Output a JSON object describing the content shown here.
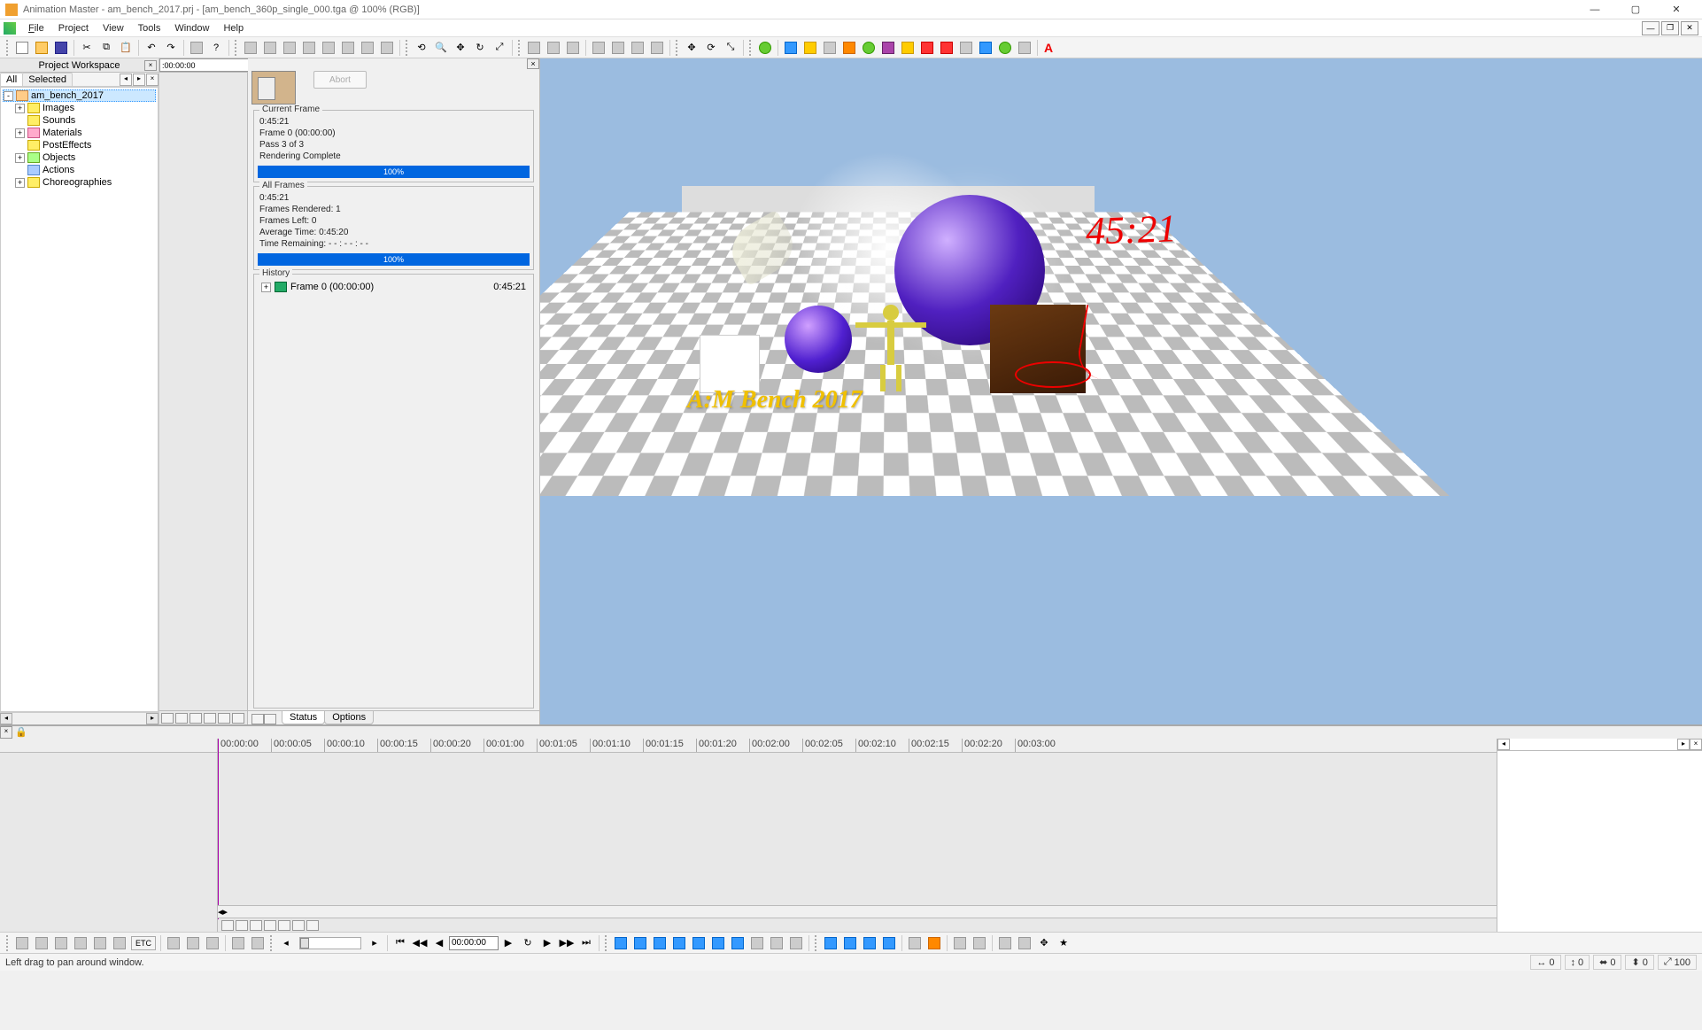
{
  "title": "Animation Master - am_bench_2017.prj - [am_bench_360p_single_000.tga @ 100% (RGB)]",
  "menus": [
    "File",
    "Project",
    "View",
    "Tools",
    "Window",
    "Help"
  ],
  "workspace_label": "Project Workspace",
  "tabs": {
    "all": "All",
    "selected": "Selected"
  },
  "tree": {
    "root": "am_bench_2017",
    "items": [
      "Images",
      "Sounds",
      "Materials",
      "PostEffects",
      "Objects",
      "Actions",
      "Choreographies"
    ]
  },
  "timeline_box": ":00:00:00",
  "timeline_box2": "00:00:0",
  "render": {
    "abort": "Abort",
    "current_frame_title": "Current Frame",
    "cf_time": "0:45:21",
    "cf_frame": "Frame 0 (00:00:00)",
    "cf_pass": "Pass 3 of 3",
    "cf_status": "Rendering Complete",
    "cf_progress": "100%",
    "all_frames_title": "All Frames",
    "af_time": "0:45:21",
    "af_rendered": "Frames Rendered: 1",
    "af_left": "Frames Left: 0",
    "af_avg": "Average Time:   0:45:20",
    "af_remain": "Time Remaining: - - : - - : - -",
    "af_progress": "100%",
    "history_title": "History",
    "history_item": "Frame 0 (00:00:00)",
    "history_time": "0:45:21",
    "tab_status": "Status",
    "tab_options": "Options"
  },
  "bench_text": "A:M Bench 2017",
  "annotation_time": "45:21",
  "tl_marks": [
    "00:00:00",
    "00:00:05",
    "00:00:10",
    "00:00:15",
    "00:00:20",
    "00:01:00",
    "00:01:05",
    "00:01:10",
    "00:01:15",
    "00:01:20",
    "00:02:00",
    "00:02:05",
    "00:02:10",
    "00:02:15",
    "00:02:20",
    "00:03:00"
  ],
  "playback_time": "00:00:00",
  "status_hint": "Left drag to pan around window.",
  "status_vals": {
    "a": "0",
    "b": "0",
    "c": "0",
    "d": "0",
    "e": "100"
  }
}
